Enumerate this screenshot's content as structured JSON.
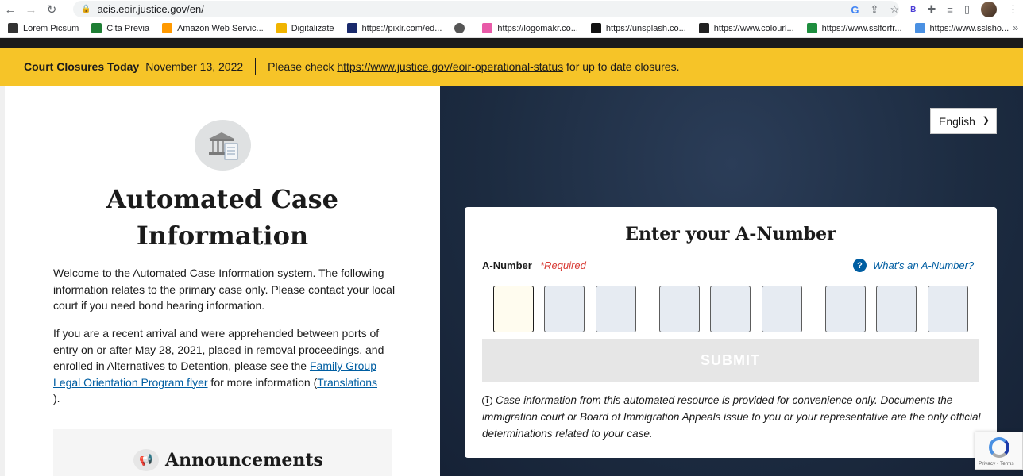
{
  "browser": {
    "url": "acis.eoir.justice.gov/en/",
    "bookmarks": [
      {
        "label": "Lorem Picsum",
        "color": "#333333"
      },
      {
        "label": "Cita Previa",
        "color": "#1e7e34"
      },
      {
        "label": "Amazon Web Servic...",
        "color": "#ff9900"
      },
      {
        "label": "Digitalizate",
        "color": "#f0b400"
      },
      {
        "label": "https://pixlr.com/ed...",
        "color": "#1a2a6c"
      },
      {
        "label": "",
        "color": "#555555"
      },
      {
        "label": "https://logomakr.co...",
        "color": "#e85aa8"
      },
      {
        "label": "https://unsplash.co...",
        "color": "#111111"
      },
      {
        "label": "https://www.colourl...",
        "color": "#222222"
      },
      {
        "label": "https://www.sslforfr...",
        "color": "#1e8e3e"
      },
      {
        "label": "https://www.sslsho...",
        "color": "#4a90e2"
      }
    ]
  },
  "alert": {
    "title": "Court Closures Today",
    "date": "November 13, 2022",
    "prefix": "Please check ",
    "link": "https://www.justice.gov/eoir-operational-status",
    "suffix": " for up to date closures."
  },
  "left": {
    "title": "Automated Case Information",
    "para1": "Welcome to the Automated Case Information system. The following information relates to the primary case only. Please contact your local court if you need bond hearing information.",
    "para2_before": "If you are a recent arrival and were apprehended between ports of entry on or after May 28, 2021, placed in removal proceedings, and enrolled in Alternatives to Detention, please see the ",
    "para2_link": "Family Group Legal Orientation Program flyer",
    "para2_mid": " for more information (",
    "para2_link2": "Translations",
    "para2_after": ").",
    "announcements": "Announcements"
  },
  "language": {
    "selected": "English"
  },
  "form": {
    "title": "Enter your A-Number",
    "label": "A-Number",
    "required": "*Required",
    "help": "What’s an A-Number?",
    "submit": "SUBMIT",
    "disclaimer": "Case information from this automated resource is provided for convenience only. Documents the immigration court or Board of Immigration Appeals issue to you or your representative are the only official determinations related to your case."
  },
  "recaptcha": {
    "text": "Privacy - Terms"
  }
}
